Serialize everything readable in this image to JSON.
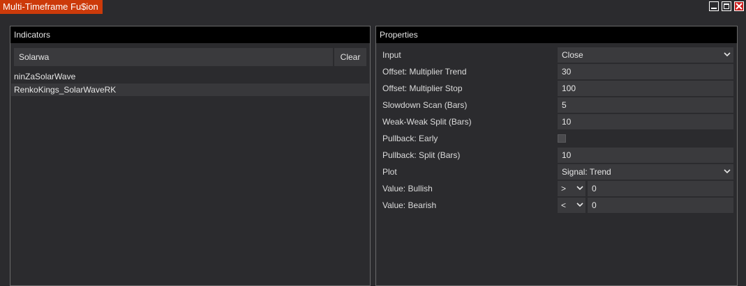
{
  "window": {
    "title": "Multi-Timeframe Fu$ion",
    "colors": {
      "title_tab": "#cc3a0a",
      "close_button": "#cc1f1f",
      "header": "#000000",
      "field": "#3a3a3d"
    }
  },
  "indicators": {
    "header": "Indicators",
    "search": {
      "value": "Solarwa",
      "placeholder": ""
    },
    "clear_label": "Clear",
    "items": [
      {
        "label": "ninZaSolarWave",
        "selected": false
      },
      {
        "label": "RenkoKings_SolarWaveRK",
        "selected": true
      }
    ]
  },
  "properties": {
    "header": "Properties",
    "rows": [
      {
        "label": "Input",
        "value": "Close",
        "type": "select"
      },
      {
        "label": "Offset: Multiplier Trend",
        "value": "30",
        "type": "text"
      },
      {
        "label": "Offset: Multiplier Stop",
        "value": "100",
        "type": "text"
      },
      {
        "label": "Slowdown Scan (Bars)",
        "value": "5",
        "type": "text"
      },
      {
        "label": "Weak-Weak Split (Bars)",
        "value": "10",
        "type": "text"
      },
      {
        "label": "Pullback: Early",
        "checked": false,
        "type": "checkbox"
      },
      {
        "label": "Pullback: Split (Bars)",
        "value": "10",
        "type": "text"
      },
      {
        "label": "Plot",
        "value": "Signal: Trend",
        "type": "select"
      },
      {
        "label": "Value: Bullish",
        "operator": ">",
        "value": "0",
        "type": "compare"
      },
      {
        "label": "Value: Bearish",
        "operator": "<",
        "value": "0",
        "type": "compare"
      }
    ]
  }
}
